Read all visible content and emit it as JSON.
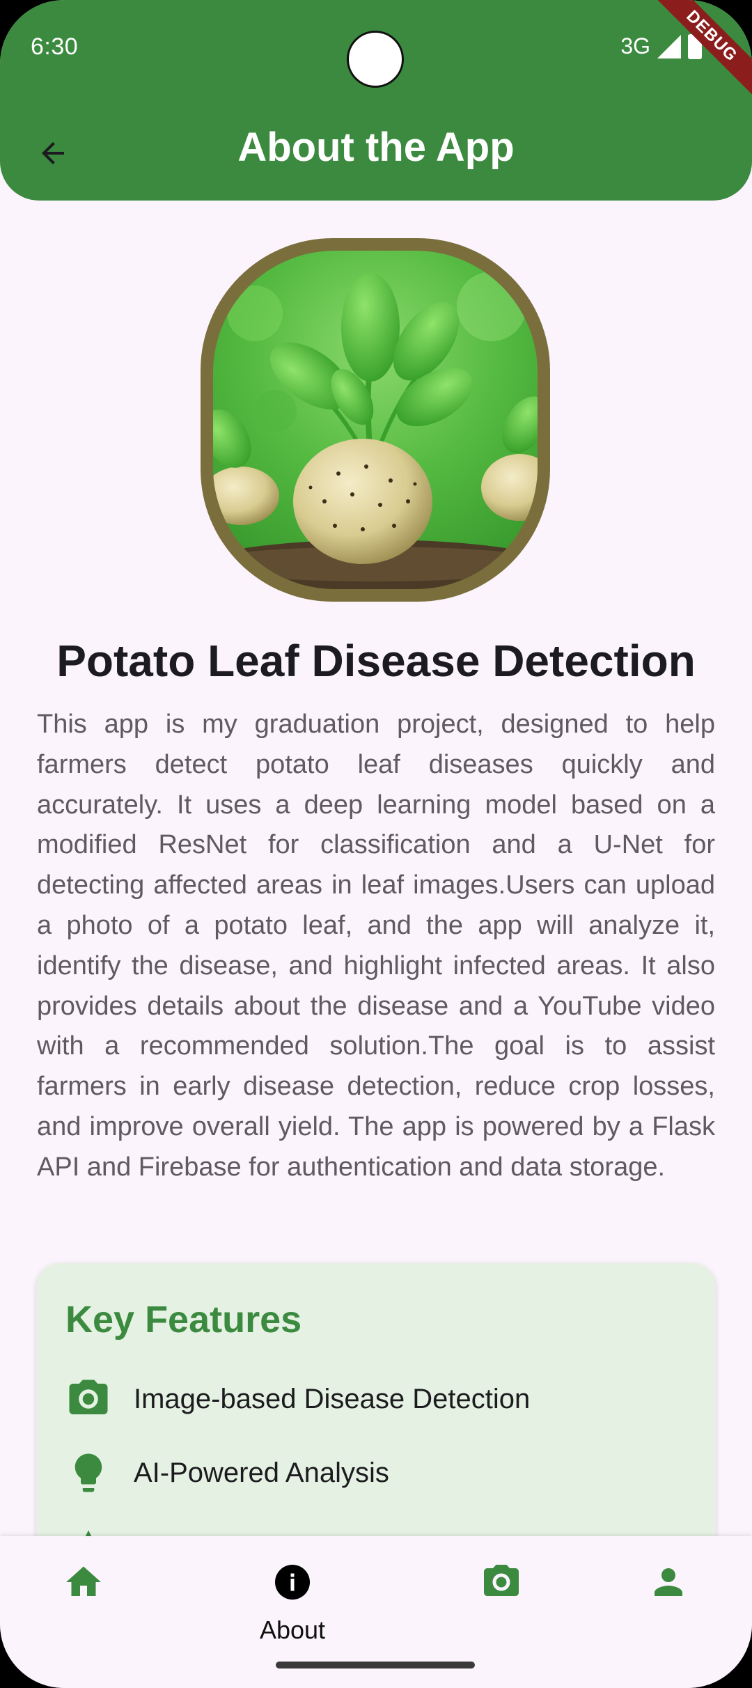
{
  "status_bar": {
    "time": "6:30",
    "network": "3G",
    "debug_label": "DEBUG"
  },
  "appbar": {
    "title": "About the App",
    "back_icon": "arrow-back-icon"
  },
  "hero": {
    "image_description_icon": "potato-plant-image"
  },
  "main": {
    "title": "Potato Leaf Disease Detection",
    "description": "This app is my graduation project, designed to help farmers detect potato leaf diseases quickly and accurately. It uses a deep learning model based on a modified ResNet for classification and a U-Net for detecting affected areas in leaf images.Users can upload a photo of a potato leaf, and the app will analyze it, identify the disease, and highlight infected areas. It also provides details about the disease and a YouTube video with a recommended solution.The goal is to assist farmers in early disease detection, reduce crop losses, and improve overall yield. The app is powered by a Flask API and Firebase for authentication and data storage."
  },
  "features": {
    "title": "Key Features",
    "items": [
      {
        "label": "Image-based Disease Detection",
        "icon": "camera-icon"
      },
      {
        "label": "AI-Powered Analysis",
        "icon": "lightbulb-icon"
      }
    ]
  },
  "bottom_nav": {
    "items": [
      {
        "label": "",
        "icon": "home-icon",
        "selected": false
      },
      {
        "label": "About",
        "icon": "info-icon",
        "selected": true
      },
      {
        "label": "",
        "icon": "camera-icon",
        "selected": false
      },
      {
        "label": "",
        "icon": "person-icon",
        "selected": false
      }
    ]
  },
  "colors": {
    "primary": "#3b8a3f",
    "background": "#fcf4fc",
    "card": "#e5f2e3",
    "debug": "#8b1d1d"
  }
}
